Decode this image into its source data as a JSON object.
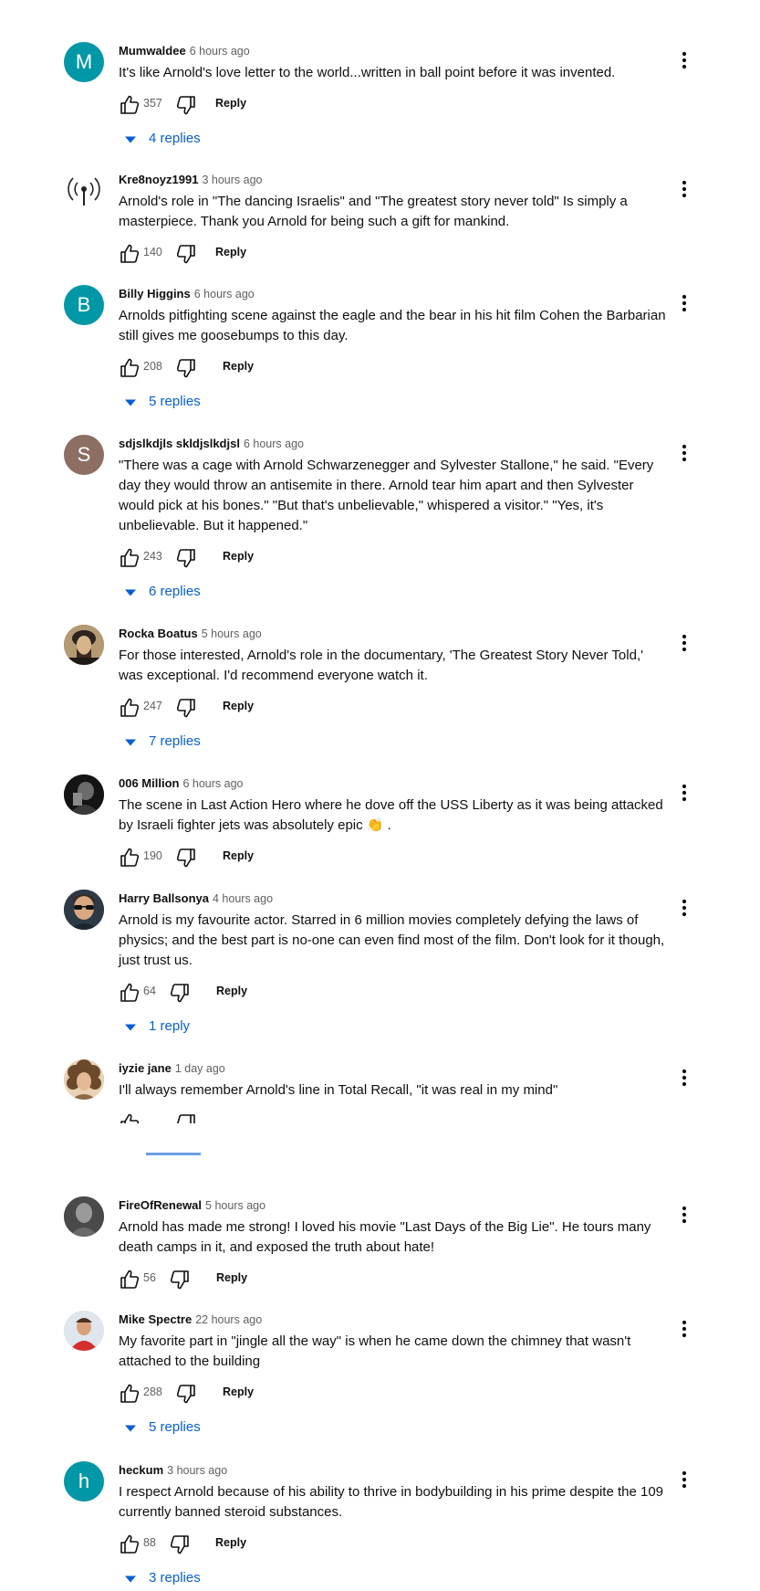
{
  "colors": {
    "link_blue": "#065fd4",
    "secondary_text": "#606060"
  },
  "comments": [
    {
      "author": "Mumwaldee",
      "time": "6 hours ago",
      "text": "It's like Arnold's love letter to the world...written in ball point before it was invented.",
      "likes": "357",
      "reply": "Reply",
      "replies": "4 replies",
      "avatar": {
        "type": "letter",
        "letter": "M",
        "color": "#0097a7"
      }
    },
    {
      "author": "Kre8noyz1991",
      "time": "3 hours ago",
      "text": "Arnold's role in \"The dancing Israelis\" and \"The greatest story never told\" Is simply a masterpiece. Thank you Arnold for being such a gift for mankind.",
      "likes": "140",
      "reply": "Reply",
      "avatar": {
        "type": "antenna-icon"
      }
    },
    {
      "author": "Billy Higgins",
      "time": "6 hours ago",
      "text": "Arnolds pitfighting scene against the eagle and the bear in his hit film Cohen the Barbarian still gives me goosebumps to this day.",
      "likes": "208",
      "reply": "Reply",
      "replies": "5 replies",
      "avatar": {
        "type": "letter",
        "letter": "B",
        "color": "#0097a7"
      }
    },
    {
      "author": "sdjslkdjls skldjslkdjsl",
      "time": "6 hours ago",
      "text": "\"There was a cage with Arnold Schwarzenegger and Sylvester Stallone,\" he said. \"Every day they would throw an antisemite in there. Arnold tear him apart and then Sylvester would pick at his bones.\" \"But that's unbelievable,\" whispered a visitor.\" \"Yes, it's unbelievable. But it happened.\"",
      "likes": "243",
      "reply": "Reply",
      "replies": "6 replies",
      "avatar": {
        "type": "letter",
        "letter": "S",
        "color": "#8d6e63"
      }
    },
    {
      "author": "Rocka Boatus",
      "time": "5 hours ago",
      "text": "For those interested, Arnold's role in the documentary, 'The Greatest Story Never Told,' was exceptional. I'd recommend everyone watch it.",
      "likes": "247",
      "reply": "Reply",
      "replies": "7 replies",
      "avatar": {
        "type": "photo-portrait"
      }
    },
    {
      "author": "006 Million",
      "time": "6 hours ago",
      "text": "The scene in Last Action Hero where he dove off the USS Liberty as it was being attacked by Israeli fighter jets was absolutely epic 👏 .",
      "likes": "190",
      "reply": "Reply",
      "avatar": {
        "type": "photo-dark"
      }
    },
    {
      "author": "Harry Ballsonya",
      "time": "4 hours ago",
      "text": "Arnold is my favourite actor. Starred in 6 million movies completely defying the laws of physics; and the best part is no-one can even find most of the film. Don't look for it though, just trust us.",
      "likes": "64",
      "reply": "Reply",
      "replies": "1 reply",
      "avatar": {
        "type": "photo-sunglasses"
      }
    },
    {
      "author": "iyzie jane",
      "time": "1 day ago",
      "text": "I'll always remember Arnold's line in Total Recall, \"it was real in my mind\"",
      "avatar": {
        "type": "photo-curly"
      }
    },
    {
      "author": "FireOfRenewal",
      "time": "5 hours ago",
      "text": "Arnold has made me strong! I loved his movie \"Last Days of the Big Lie\". He tours many death camps in it, and exposed the truth about hate!",
      "likes": "56",
      "reply": "Reply",
      "avatar": {
        "type": "photo-grey"
      }
    },
    {
      "author": "Mike Spectre",
      "time": "22 hours ago",
      "text": "My favorite part in \"jingle all the way\" is when he came down the chimney that wasn't attached to the building",
      "likes": "288",
      "reply": "Reply",
      "replies": "5 replies",
      "avatar": {
        "type": "photo-red"
      }
    },
    {
      "author": "heckum",
      "time": "3 hours ago",
      "text": "I respect Arnold because of his ability to thrive in bodybuilding in his prime despite the 109 currently banned steroid substances.",
      "likes": "88",
      "reply": "Reply",
      "replies": "3 replies",
      "avatar": {
        "type": "letter",
        "letter": "h",
        "color": "#0097a7"
      }
    }
  ]
}
